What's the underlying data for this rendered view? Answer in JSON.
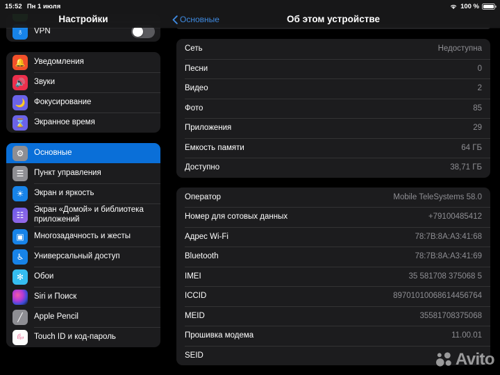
{
  "statusbar": {
    "time": "15:52",
    "date": "Пн 1 июля",
    "wifi_icon": "wifi-icon",
    "battery_percent": "100 %",
    "battery_icon": "battery-full-icon"
  },
  "sidebar": {
    "title": "Настройки",
    "groups": [
      {
        "items": [
          {
            "label": "",
            "icon": "green-partial-icon",
            "icon_class": "ic-green",
            "glyph": "",
            "partial": true
          },
          {
            "label": "VPN",
            "icon": "vpn-icon",
            "icon_class": "ic-vpn",
            "glyph": "♁",
            "toggle": "off"
          }
        ]
      },
      {
        "items": [
          {
            "label": "Уведомления",
            "icon": "notifications-icon",
            "icon_class": "ic-notif",
            "glyph": "🔔"
          },
          {
            "label": "Звуки",
            "icon": "sounds-icon",
            "icon_class": "ic-sound",
            "glyph": "🔊"
          },
          {
            "label": "Фокусирование",
            "icon": "focus-icon",
            "icon_class": "ic-focus",
            "glyph": "🌙"
          },
          {
            "label": "Экранное время",
            "icon": "screen-time-icon",
            "icon_class": "ic-screent",
            "glyph": "⌛"
          }
        ]
      },
      {
        "items": [
          {
            "label": "Основные",
            "icon": "general-icon",
            "icon_class": "ic-general",
            "glyph": "⚙",
            "selected": true
          },
          {
            "label": "Пункт управления",
            "icon": "control-center-icon",
            "icon_class": "ic-control",
            "glyph": "☰"
          },
          {
            "label": "Экран и яркость",
            "icon": "display-brightness-icon",
            "icon_class": "ic-display",
            "glyph": "☀"
          },
          {
            "label": "Экран «Домой» и библиотека приложений",
            "icon": "home-screen-icon",
            "icon_class": "ic-home",
            "glyph": "☷"
          },
          {
            "label": "Многозадачность и жесты",
            "icon": "multitasking-icon",
            "icon_class": "ic-multi",
            "glyph": "▣"
          },
          {
            "label": "Универсальный доступ",
            "icon": "accessibility-icon",
            "icon_class": "ic-access",
            "glyph": "♿"
          },
          {
            "label": "Обои",
            "icon": "wallpaper-icon",
            "icon_class": "ic-wall",
            "glyph": "✻"
          },
          {
            "label": "Siri и Поиск",
            "icon": "siri-icon",
            "icon_class": "ic-siri",
            "glyph": ""
          },
          {
            "label": "Apple Pencil",
            "icon": "apple-pencil-icon",
            "icon_class": "ic-pencil",
            "glyph": "╱"
          },
          {
            "label": "Touch ID и код-пароль",
            "icon": "touch-id-icon",
            "icon_class": "ic-touch",
            "glyph": ""
          }
        ]
      }
    ]
  },
  "detail": {
    "back_label": "Основные",
    "back_icon": "chevron-left-icon",
    "title": "Об этом устройстве",
    "groups": [
      {
        "rows": [
          {
            "label": "Сеть",
            "value": "Недоступна"
          },
          {
            "label": "Песни",
            "value": "0"
          },
          {
            "label": "Видео",
            "value": "2"
          },
          {
            "label": "Фото",
            "value": "85"
          },
          {
            "label": "Приложения",
            "value": "29"
          },
          {
            "label": "Емкость памяти",
            "value": "64 ГБ"
          },
          {
            "label": "Доступно",
            "value": "38,71 ГБ"
          }
        ]
      },
      {
        "rows": [
          {
            "label": "Оператор",
            "value": "Mobile TeleSystems 58.0"
          },
          {
            "label": "Номер для сотовых данных",
            "value": "+79100485412"
          },
          {
            "label": "Адрес Wi-Fi",
            "value": "78:7B:8A:A3:41:68"
          },
          {
            "label": "Bluetooth",
            "value": "78:7B:8A:A3:41:69"
          },
          {
            "label": "IMEI",
            "value": "35 581708 375068 5"
          },
          {
            "label": "ICCID",
            "value": "89701010068614456764"
          },
          {
            "label": "MEID",
            "value": "35581708375068"
          },
          {
            "label": "Прошивка модема",
            "value": "11.00.01"
          },
          {
            "label": "SEID",
            "value": "",
            "chevron": true
          }
        ]
      }
    ]
  },
  "watermark": {
    "text": "Avito",
    "logo_icon": "avito-logo-icon"
  }
}
